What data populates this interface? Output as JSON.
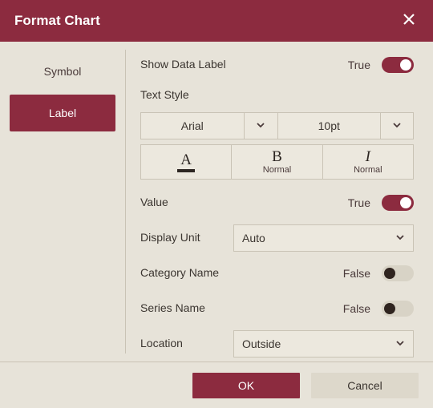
{
  "title": "Format Chart",
  "tabs": {
    "symbol": "Symbol",
    "label": "Label",
    "active": "label"
  },
  "panel": {
    "showDataLabel": {
      "label": "Show Data Label",
      "state": "True",
      "on": true
    },
    "textStyle": {
      "label": "Text Style",
      "font": "Arial",
      "size": "10pt",
      "colorCell": {
        "letter": "A"
      },
      "bold": {
        "letter": "B",
        "sub": "Normal"
      },
      "italic": {
        "letter": "I",
        "sub": "Normal"
      }
    },
    "value": {
      "label": "Value",
      "state": "True",
      "on": true
    },
    "displayUnit": {
      "label": "Display Unit",
      "value": "Auto"
    },
    "categoryName": {
      "label": "Category Name",
      "state": "False",
      "on": false
    },
    "seriesName": {
      "label": "Series Name",
      "state": "False",
      "on": false
    },
    "location": {
      "label": "Location",
      "value": "Outside"
    }
  },
  "footer": {
    "ok": "OK",
    "cancel": "Cancel"
  }
}
